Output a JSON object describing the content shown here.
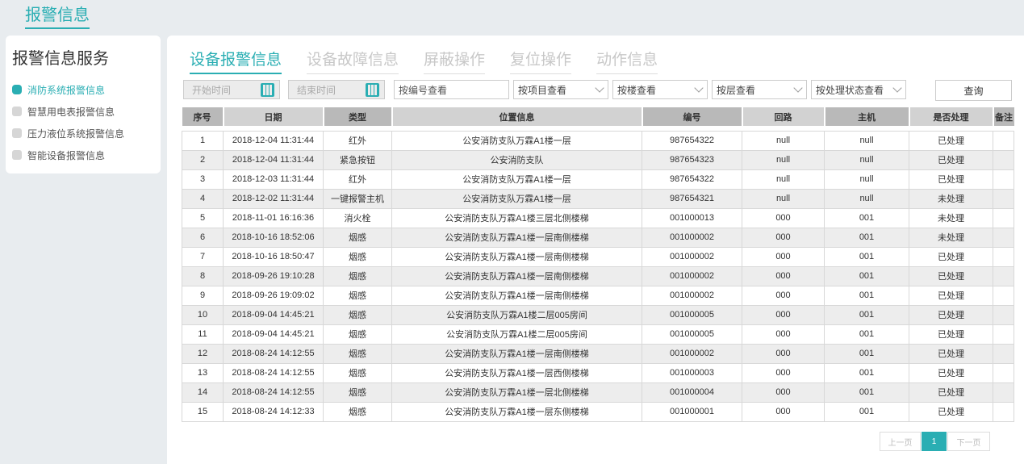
{
  "page_title": "报警信息",
  "sidebar": {
    "title": "报警信息服务",
    "items": [
      {
        "label": "消防系统报警信息"
      },
      {
        "label": "智慧用电表报警信息"
      },
      {
        "label": "压力液位系统报警信息"
      },
      {
        "label": "智能设备报警信息"
      }
    ]
  },
  "tabs": [
    {
      "label": "设备报警信息"
    },
    {
      "label": "设备故障信息"
    },
    {
      "label": "屏蔽操作"
    },
    {
      "label": "复位操作"
    },
    {
      "label": "动作信息"
    }
  ],
  "filters": {
    "start_time": "开始时间",
    "end_time": "结束时间",
    "code_search": "按编号查看",
    "project": "按项目查看",
    "building": "按楼查看",
    "floor": "按层查看",
    "status": "按处理状态查看",
    "query": "查询"
  },
  "table": {
    "headers": [
      "序号",
      "日期",
      "类型",
      "位置信息",
      "编号",
      "回路",
      "主机",
      "是否处理",
      "备注"
    ],
    "rows": [
      [
        "1",
        "2018-12-04 11:31:44",
        "红外",
        "公安消防支队万霖A1楼一层",
        "987654322",
        "null",
        "null",
        "已处理",
        ""
      ],
      [
        "2",
        "2018-12-04 11:31:44",
        "紧急按钮",
        "公安消防支队",
        "987654323",
        "null",
        "null",
        "已处理",
        ""
      ],
      [
        "3",
        "2018-12-03 11:31:44",
        "红外",
        "公安消防支队万霖A1楼一层",
        "987654322",
        "null",
        "null",
        "已处理",
        ""
      ],
      [
        "4",
        "2018-12-02 11:31:44",
        "一键报警主机",
        "公安消防支队万霖A1楼一层",
        "987654321",
        "null",
        "null",
        "未处理",
        ""
      ],
      [
        "5",
        "2018-11-01 16:16:36",
        "消火栓",
        "公安消防支队万霖A1楼三层北侧楼梯",
        "001000013",
        "000",
        "001",
        "未处理",
        ""
      ],
      [
        "6",
        "2018-10-16 18:52:06",
        "烟感",
        "公安消防支队万霖A1楼一层南侧楼梯",
        "001000002",
        "000",
        "001",
        "未处理",
        ""
      ],
      [
        "7",
        "2018-10-16 18:50:47",
        "烟感",
        "公安消防支队万霖A1楼一层南侧楼梯",
        "001000002",
        "000",
        "001",
        "已处理",
        ""
      ],
      [
        "8",
        "2018-09-26 19:10:28",
        "烟感",
        "公安消防支队万霖A1楼一层南侧楼梯",
        "001000002",
        "000",
        "001",
        "已处理",
        ""
      ],
      [
        "9",
        "2018-09-26 19:09:02",
        "烟感",
        "公安消防支队万霖A1楼一层南侧楼梯",
        "001000002",
        "000",
        "001",
        "已处理",
        ""
      ],
      [
        "10",
        "2018-09-04 14:45:21",
        "烟感",
        "公安消防支队万霖A1楼二层005房间",
        "001000005",
        "000",
        "001",
        "已处理",
        ""
      ],
      [
        "11",
        "2018-09-04 14:45:21",
        "烟感",
        "公安消防支队万霖A1楼二层005房间",
        "001000005",
        "000",
        "001",
        "已处理",
        ""
      ],
      [
        "12",
        "2018-08-24 14:12:55",
        "烟感",
        "公安消防支队万霖A1楼一层南侧楼梯",
        "001000002",
        "000",
        "001",
        "已处理",
        ""
      ],
      [
        "13",
        "2018-08-24 14:12:55",
        "烟感",
        "公安消防支队万霖A1楼一层西侧楼梯",
        "001000003",
        "000",
        "001",
        "已处理",
        ""
      ],
      [
        "14",
        "2018-08-24 14:12:55",
        "烟感",
        "公安消防支队万霖A1楼一层北侧楼梯",
        "001000004",
        "000",
        "001",
        "已处理",
        ""
      ],
      [
        "15",
        "2018-08-24 14:12:33",
        "烟感",
        "公安消防支队万霖A1楼一层东侧楼梯",
        "001000001",
        "000",
        "001",
        "已处理",
        ""
      ]
    ]
  },
  "pagination": {
    "prev": "上一页",
    "current": "1",
    "next": "下一页"
  }
}
